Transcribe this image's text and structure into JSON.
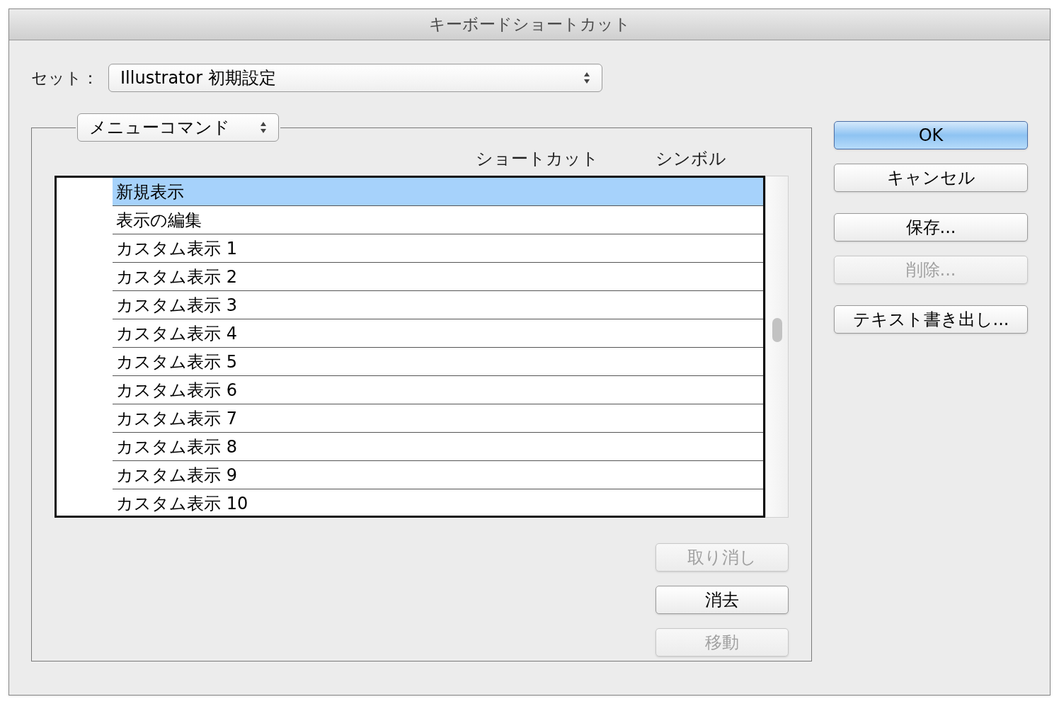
{
  "window": {
    "title": "キーボードショートカット"
  },
  "set": {
    "label": "セット：",
    "value": "Illustrator 初期設定"
  },
  "category": {
    "value": "メニューコマンド"
  },
  "columns": {
    "shortcut": "ショートカット",
    "symbol": "シンボル"
  },
  "rows": [
    {
      "label": "新規表示",
      "selected": true
    },
    {
      "label": "表示の編集",
      "selected": false
    },
    {
      "label": "カスタム表示 1",
      "selected": false
    },
    {
      "label": "カスタム表示 2",
      "selected": false
    },
    {
      "label": "カスタム表示 3",
      "selected": false
    },
    {
      "label": "カスタム表示 4",
      "selected": false
    },
    {
      "label": "カスタム表示 5",
      "selected": false
    },
    {
      "label": "カスタム表示 6",
      "selected": false
    },
    {
      "label": "カスタム表示 7",
      "selected": false
    },
    {
      "label": "カスタム表示 8",
      "selected": false
    },
    {
      "label": "カスタム表示 9",
      "selected": false
    },
    {
      "label": "カスタム表示 10",
      "selected": false
    }
  ],
  "edit_buttons": [
    {
      "label": "取り消し",
      "disabled": true
    },
    {
      "label": "消去",
      "disabled": false
    },
    {
      "label": "移動",
      "disabled": true
    }
  ],
  "side_buttons": [
    {
      "label": "OK",
      "default": true,
      "disabled": false
    },
    {
      "label": "キャンセル",
      "default": false,
      "disabled": false
    },
    {
      "label": "保存...",
      "default": false,
      "disabled": false
    },
    {
      "label": "削除...",
      "default": false,
      "disabled": true
    },
    {
      "label": "テキスト書き出し...",
      "default": false,
      "disabled": false
    }
  ]
}
